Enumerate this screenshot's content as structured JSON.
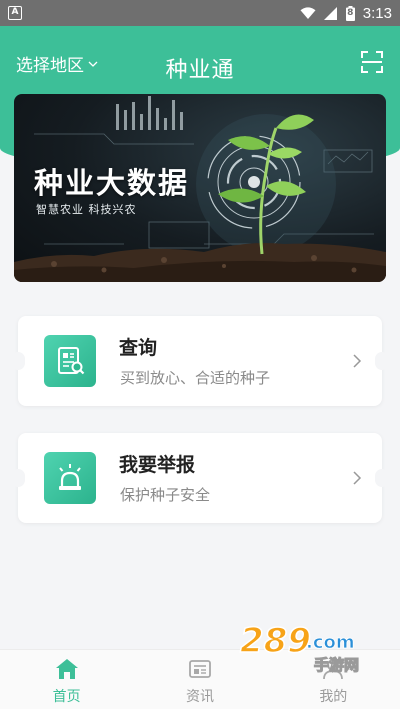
{
  "status_bar": {
    "app_badge": "A",
    "battery_level": "8",
    "time": "3:13"
  },
  "header": {
    "region_label": "选择地区",
    "title": "种业通",
    "scan_icon": "scan-frame-icon"
  },
  "banner": {
    "title": "种业大数据",
    "subtitle": "智慧农业 科技兴农"
  },
  "cards": [
    {
      "title": "查询",
      "description": "买到放心、合适的种子",
      "icon": "document-search-icon"
    },
    {
      "title": "我要举报",
      "description": "保护种子安全",
      "icon": "alarm-light-icon"
    }
  ],
  "tabs": [
    {
      "label": "首页",
      "icon": "home-icon",
      "active": true
    },
    {
      "label": "资讯",
      "icon": "news-icon",
      "active": false
    },
    {
      "label": "我的",
      "icon": "profile-icon",
      "active": false
    }
  ],
  "watermark": {
    "logo_text": "289",
    "domain_suffix": ".com",
    "site_name": "手游网"
  },
  "colors": {
    "brand_green": "#3dbf98",
    "status_bar_gray": "#6f6f6f",
    "inactive_gray": "#9a9a9a"
  }
}
